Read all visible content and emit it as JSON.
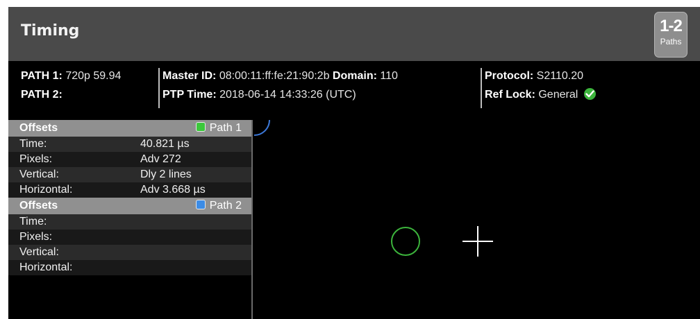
{
  "header": {
    "title": "Timing",
    "paths_badge": {
      "top": "1-2",
      "bottom": "Paths"
    }
  },
  "info": {
    "path1_label": "PATH 1:",
    "path1_value": "720p 59.94",
    "path2_label": "PATH 2:",
    "path2_value": "",
    "master_id_label": "Master ID:",
    "master_id_value": "08:00:11:ff:fe:21:90:2b",
    "domain_label": "Domain:",
    "domain_value": "110",
    "ptp_time_label": "PTP Time:",
    "ptp_time_value": "2018-06-14 14:33:26 (UTC)",
    "protocol_label": "Protocol:",
    "protocol_value": "S2110.20",
    "ref_lock_label": "Ref Lock:",
    "ref_lock_value": "General",
    "ref_lock_status": "ok",
    "status_color": "#3cb43c"
  },
  "offsets": [
    {
      "header": "Offsets",
      "path_label": "Path 1",
      "color": "#3cc83c",
      "rows": [
        {
          "label": "Time:",
          "value": "40.821 µs"
        },
        {
          "label": "Pixels:",
          "value": "Adv 272"
        },
        {
          "label": "Vertical:",
          "value": "Dly 2 lines"
        },
        {
          "label": "Horizontal:",
          "value": "Adv 3.668 µs"
        }
      ]
    },
    {
      "header": "Offsets",
      "path_label": "Path 2",
      "color": "#3c8ce6",
      "rows": [
        {
          "label": "Time:",
          "value": ""
        },
        {
          "label": "Pixels:",
          "value": ""
        },
        {
          "label": "Vertical:",
          "value": ""
        },
        {
          "label": "Horizontal:",
          "value": ""
        }
      ]
    }
  ],
  "display": {
    "path1_marker": "green-circle",
    "reference_marker": "white-crosshair",
    "path1_color": "#3cb43c",
    "arc_color": "#3c78d8"
  }
}
